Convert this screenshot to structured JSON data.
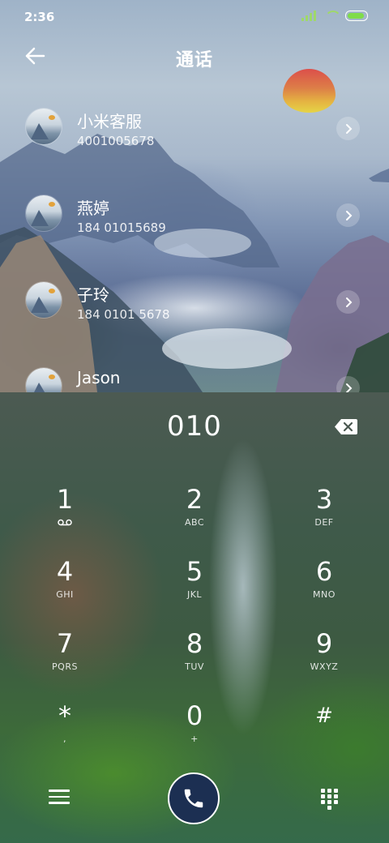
{
  "status_bar": {
    "time": "2:36"
  },
  "header": {
    "title": "通话"
  },
  "contacts": [
    {
      "name": "小米客服",
      "number": "4001005678"
    },
    {
      "name": "燕婷",
      "number": "184 01015689"
    },
    {
      "name": "子玲",
      "number": "184 0101 5678"
    },
    {
      "name": "Jason",
      "number": ""
    }
  ],
  "dialer": {
    "dialed": "010",
    "keys": [
      {
        "digit": "1",
        "letters": ""
      },
      {
        "digit": "2",
        "letters": "ABC"
      },
      {
        "digit": "3",
        "letters": "DEF"
      },
      {
        "digit": "4",
        "letters": "GHI"
      },
      {
        "digit": "5",
        "letters": "JKL"
      },
      {
        "digit": "6",
        "letters": "MNO"
      },
      {
        "digit": "7",
        "letters": "PQRS"
      },
      {
        "digit": "8",
        "letters": "TUV"
      },
      {
        "digit": "9",
        "letters": "WXYZ"
      },
      {
        "digit": "*",
        "letters": ","
      },
      {
        "digit": "0",
        "letters": "+"
      },
      {
        "digit": "#",
        "letters": ""
      }
    ]
  },
  "colors": {
    "call_button": "#1c2f52",
    "battery": "#7fdc4a",
    "signal": "#9fd86a"
  },
  "icons": [
    "back-arrow-icon",
    "chevron-right-icon",
    "backspace-icon",
    "voicemail-icon",
    "menu-icon",
    "phone-icon",
    "keypad-icon"
  ]
}
